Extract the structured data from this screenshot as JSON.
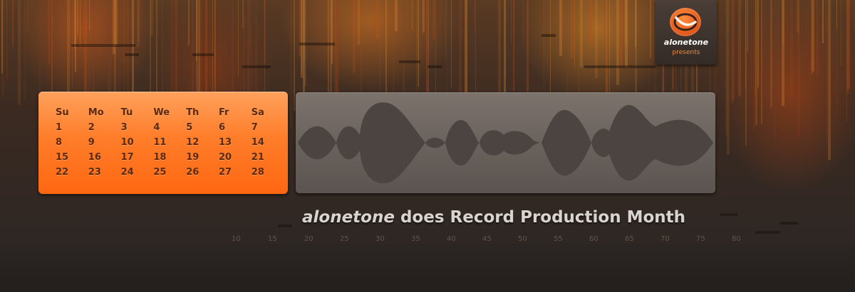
{
  "badge": {
    "name": "alonetone",
    "sub": "presents",
    "logo_icon": "alonetone-logo-icon"
  },
  "calendar": {
    "weekdays": [
      "Su",
      "Mo",
      "Tu",
      "We",
      "Th",
      "Fr",
      "Sa"
    ],
    "weeks": [
      [
        "1",
        "2",
        "3",
        "4",
        "5",
        "6",
        "7"
      ],
      [
        "8",
        "9",
        "10",
        "11",
        "12",
        "13",
        "14"
      ],
      [
        "15",
        "16",
        "17",
        "18",
        "19",
        "20",
        "21"
      ],
      [
        "22",
        "23",
        "24",
        "25",
        "26",
        "27",
        "28"
      ]
    ]
  },
  "headline": {
    "brand": "alonetone",
    "rest": " does Record Production Month"
  },
  "ruler": [
    "10",
    "15",
    "20",
    "25",
    "30",
    "35",
    "40",
    "45",
    "50",
    "55",
    "60",
    "65",
    "70",
    "75",
    "80"
  ],
  "colors": {
    "accent": "#ff7a2a",
    "headline": "#d9d4cf",
    "panel": "#6a625d"
  }
}
